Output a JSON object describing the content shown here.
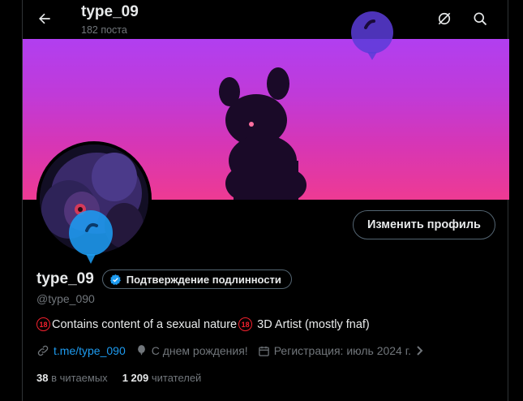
{
  "header": {
    "name": "type_09",
    "posts_count": "182 поста",
    "icons": [
      "back-arrow-icon",
      "grok-icon",
      "search-icon"
    ]
  },
  "profile": {
    "display_name": "type_09",
    "verify_label": "Подтверждение подлинности",
    "handle": "@type_090",
    "edit_button": "Изменить профиль",
    "bio": {
      "badge1": "18",
      "text1": "Contains content of a sexual nature",
      "badge2": "18",
      "text2": " 3D Artist (mostly fnaf)"
    },
    "link": "t.me/type_090",
    "birthday": "С днем рождения!",
    "joined": "Регистрация: июль 2024 г.",
    "following_count": "38",
    "following_label": " в читаемых",
    "followers_count": "1 209",
    "followers_label": " читателей"
  },
  "colors": {
    "accent": "#1d9bf0",
    "banner_top": "#b13ff0",
    "banner_bottom": "#ee3a93",
    "balloon": "#1d9bf0"
  }
}
